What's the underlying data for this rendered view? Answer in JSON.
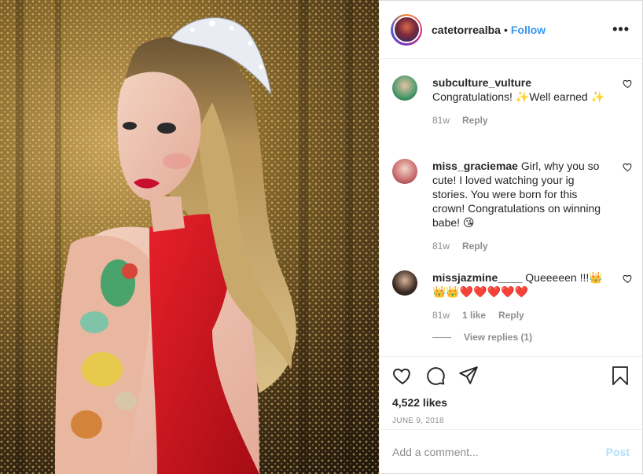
{
  "post": {
    "username": "catetorrealba",
    "dot": "•",
    "follow_label": "Follow",
    "more_label": "•••",
    "likes": "4,522 likes",
    "date": "JUNE 9, 2018"
  },
  "comments": [
    {
      "user": "subculture_vulture",
      "text": "Congratulations! ✨Well earned ✨",
      "time": "81w",
      "reply": "Reply",
      "avatar_color": "#2d8c5a"
    },
    {
      "user": "miss_graciemae",
      "text": "Girl, why you so cute! I loved watching your ig stories. You were born for this crown! Congratulations on winning babe! 😘",
      "time": "81w",
      "reply": "Reply",
      "avatar_color": "#c86a6a"
    },
    {
      "user": "missjazmine____",
      "text": "Queeeeen !!!👑👑👑❤️❤️❤️❤️❤️",
      "time": "81w",
      "likes": "1 like",
      "reply": "Reply",
      "view_replies": "View replies (1)",
      "avatar_color": "#3a2a22"
    }
  ],
  "composer": {
    "placeholder": "Add a comment...",
    "post_label": "Post"
  },
  "icons": {
    "more": "more-options-icon",
    "like": "heart-icon",
    "comment": "comment-icon",
    "share": "share-icon",
    "save": "bookmark-icon"
  },
  "colors": {
    "accent": "#3897f0",
    "post_disabled": "#b2dffc",
    "dress": "#d4141c",
    "lips": "#c8102e",
    "backdrop_gold": "#b68d3e"
  }
}
